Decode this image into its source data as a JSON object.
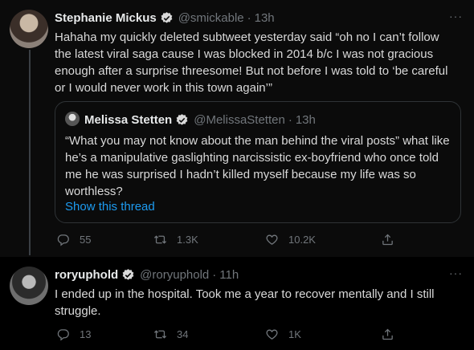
{
  "tweets": [
    {
      "name": "Stephanie Mickus",
      "handle": "@smickable",
      "separator": "·",
      "time": "13h",
      "text": "Hahaha my quickly deleted subtweet yesterday said “oh no I can’t follow the latest viral saga cause I was blocked in 2014 b/c I was not gracious enough after a surprise threesome! But not before I was told to ‘be careful or I would never work in this town again’”",
      "quote": {
        "name": "Melissa Stetten",
        "handle": "@MelissaStetten",
        "separator": "·",
        "time": "13h",
        "text": "“What you may not know about the man behind the viral posts” what like he’s a manipulative gaslighting narcissistic ex-boyfriend who once told me he was surprised I hadn’t killed myself because my life was so worthless?",
        "show_thread": "Show this thread"
      },
      "reply_count": "55",
      "retweet_count": "1.3K",
      "like_count": "10.2K"
    },
    {
      "name": "roryuphold",
      "handle": "@roryuphold",
      "separator": "·",
      "time": "11h",
      "text": "I ended up in the hospital. Took me a year to recover mentally and I still struggle.",
      "reply_count": "13",
      "retweet_count": "34",
      "like_count": "1K"
    }
  ],
  "more_label": "···",
  "colors": {
    "background": "#000000",
    "link": "#1d9bf0",
    "muted": "#71767b",
    "verified": "#d9d9d9"
  }
}
